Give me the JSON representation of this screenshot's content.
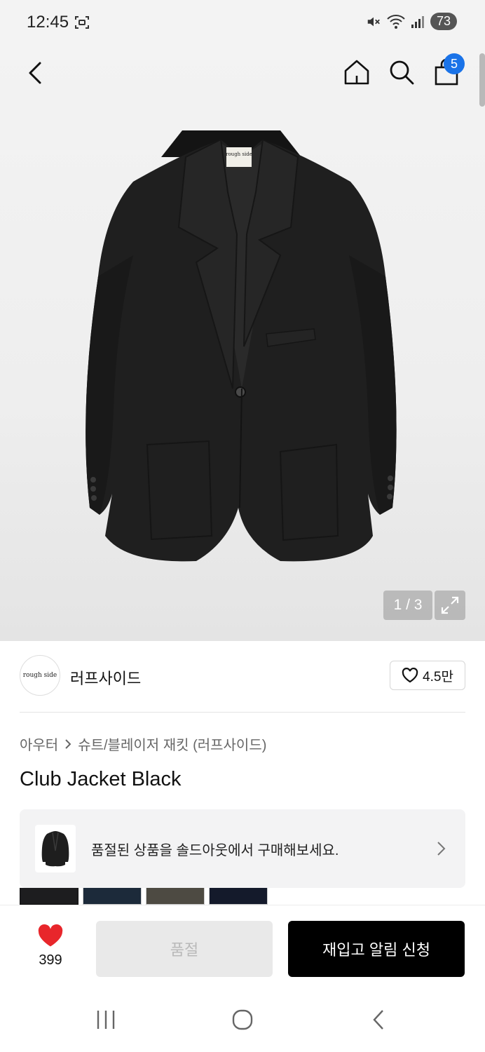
{
  "status_bar": {
    "time": "12:45",
    "battery": "73"
  },
  "header": {
    "cart_count": "5"
  },
  "gallery": {
    "pager": "1 / 3",
    "tag_text": "rough side"
  },
  "brand": {
    "logo_text": "rough side",
    "name": "러프사이드",
    "likes": "4.5만"
  },
  "breadcrumb": {
    "category": "아우터",
    "subcategory": "슈트/블레이저 재킷 (러프사이드)"
  },
  "product": {
    "title": "Club Jacket Black"
  },
  "soldout_banner": {
    "text": "품절된 상품을 솔드아웃에서 구매해보세요."
  },
  "color_options": [
    {
      "color": "#1d1d1f"
    },
    {
      "color": "#1c2a3a"
    },
    {
      "color": "#4d4a42"
    },
    {
      "color": "#141a2b"
    }
  ],
  "action_bar": {
    "wish_count": "399",
    "soldout_label": "품절",
    "restock_label": "재입고 알림 신청"
  },
  "colors": {
    "accent_badge": "#1a73e8",
    "heart": "#e8262b",
    "primary_button": "#000000"
  }
}
